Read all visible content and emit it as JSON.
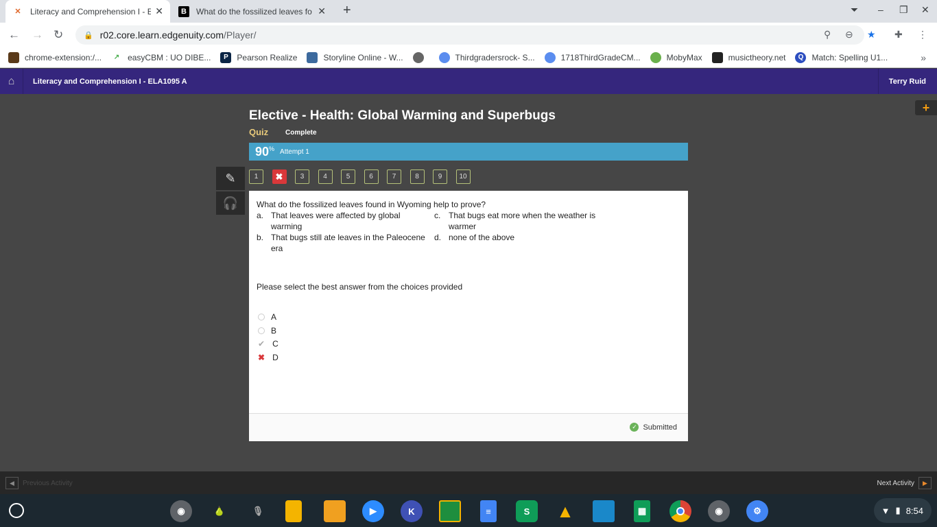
{
  "browser": {
    "tabs": [
      {
        "title": "Literacy and Comprehension I - E",
        "icon": "edgenuity-icon"
      },
      {
        "title": "What do the fossilized leaves fo",
        "icon": "brainly-icon"
      }
    ],
    "url_host": "r02.core.learn.edgenuity.com",
    "url_path": "/Player/",
    "bookmarks": [
      "chrome-extension:/...",
      "easyCBM : UO DIBE...",
      "Pearson Realize",
      "Storyline Online - W...",
      "",
      "Thirdgradersrock- S...",
      "1718ThirdGradeCM...",
      "MobyMax",
      "musictheory.net",
      "Match: Spelling U1..."
    ],
    "more": "»"
  },
  "header": {
    "course": "Literacy and Comprehension I - ELA1095 A",
    "user": "Terry Ruid"
  },
  "activity": {
    "title": "Elective - Health: Global Warming and Superbugs",
    "type": "Quiz",
    "status": "Complete",
    "score": "90",
    "score_unit": "%",
    "attempt": "Attempt 1"
  },
  "questions": [
    "1",
    "✖",
    "3",
    "4",
    "5",
    "6",
    "7",
    "8",
    "9",
    "10"
  ],
  "question": {
    "text": "What do the fossilized leaves found in Wyoming help to prove?",
    "options": [
      {
        "letter": "a.",
        "text": "That leaves were affected by global warming"
      },
      {
        "letter": "b.",
        "text": "That bugs still ate leaves in the Paleocene era"
      },
      {
        "letter": "c.",
        "text": "That bugs eat more when the weather is warmer"
      },
      {
        "letter": "d.",
        "text": "none of the above"
      }
    ],
    "instruction": "Please select the best answer from the choices provided",
    "answers": [
      {
        "label": "A",
        "state": "unselected"
      },
      {
        "label": "B",
        "state": "unselected"
      },
      {
        "label": "C",
        "state": "correct"
      },
      {
        "label": "D",
        "state": "incorrect-selected"
      }
    ],
    "status": "Submitted"
  },
  "footer": {
    "prev": "Previous Activity",
    "next": "Next Activity"
  },
  "shelf": {
    "time": "8:54"
  },
  "colors": {
    "purple": "#35267d",
    "score_bar": "#45a2c9",
    "wrong": "#d9383a"
  }
}
